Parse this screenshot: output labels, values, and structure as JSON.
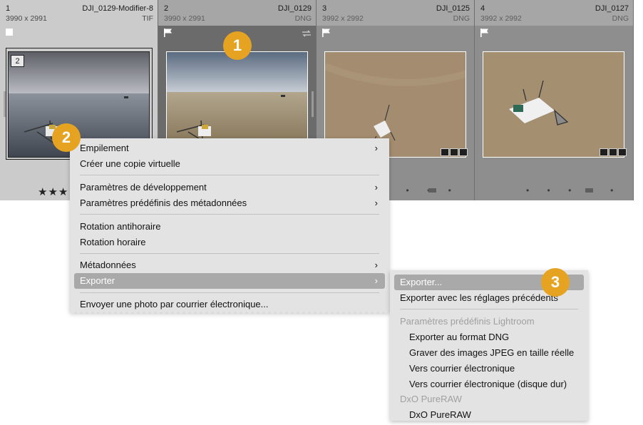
{
  "filmstrip": [
    {
      "index": "1",
      "filename": "DJI_0129-Modifier-8",
      "dims": "3990 x 2991",
      "ext": "TIF",
      "stack_count": "2",
      "stars": "★★★"
    },
    {
      "index": "2",
      "filename": "DJI_0129",
      "dims": "3990 x 2991",
      "ext": "DNG"
    },
    {
      "index": "3",
      "filename": "DJI_0125",
      "dims": "3992 x 2992",
      "ext": "DNG",
      "dots": "• • • • •"
    },
    {
      "index": "4",
      "filename": "DJI_0127",
      "dims": "3992 x 2992",
      "ext": "DNG",
      "dots": "• • • • •"
    }
  ],
  "callouts": [
    "1",
    "2",
    "3"
  ],
  "context_menu": {
    "items": [
      {
        "label": "Empilement",
        "submenu": true
      },
      {
        "label": "Créer une copie virtuelle",
        "submenu": false
      },
      {
        "label": "Paramètres de développement",
        "submenu": true
      },
      {
        "label": "Paramètres prédéfinis des métadonnées",
        "submenu": true
      },
      {
        "label": "Rotation antihoraire",
        "submenu": false
      },
      {
        "label": "Rotation horaire",
        "submenu": false
      },
      {
        "label": "Métadonnées",
        "submenu": true
      },
      {
        "label": "Exporter",
        "submenu": true,
        "highlighted": true
      },
      {
        "label": "Envoyer une photo par courrier électronique...",
        "submenu": false
      }
    ],
    "arrow": "›"
  },
  "export_submenu": {
    "items": [
      {
        "label": "Exporter...",
        "highlighted": true
      },
      {
        "label": "Exporter avec les réglages précédents"
      },
      {
        "label": "Paramètres prédéfinis Lightroom",
        "disabled": true
      },
      {
        "label": "Exporter au format DNG"
      },
      {
        "label": "Graver des images JPEG en taille réelle"
      },
      {
        "label": "Vers courrier électronique"
      },
      {
        "label": "Vers courrier électronique (disque dur)"
      },
      {
        "label": "DxO PureRAW",
        "disabled": true
      },
      {
        "label": "DxO PureRAW"
      }
    ]
  },
  "colors": {
    "strip_bg": "#8e8e8e",
    "selected_cell": "#c9c9c9",
    "active_cell": "#6a6a6a",
    "menu_bg": "#e3e3e3",
    "highlight": "#a9a9a9",
    "callout": "#e6a322"
  }
}
